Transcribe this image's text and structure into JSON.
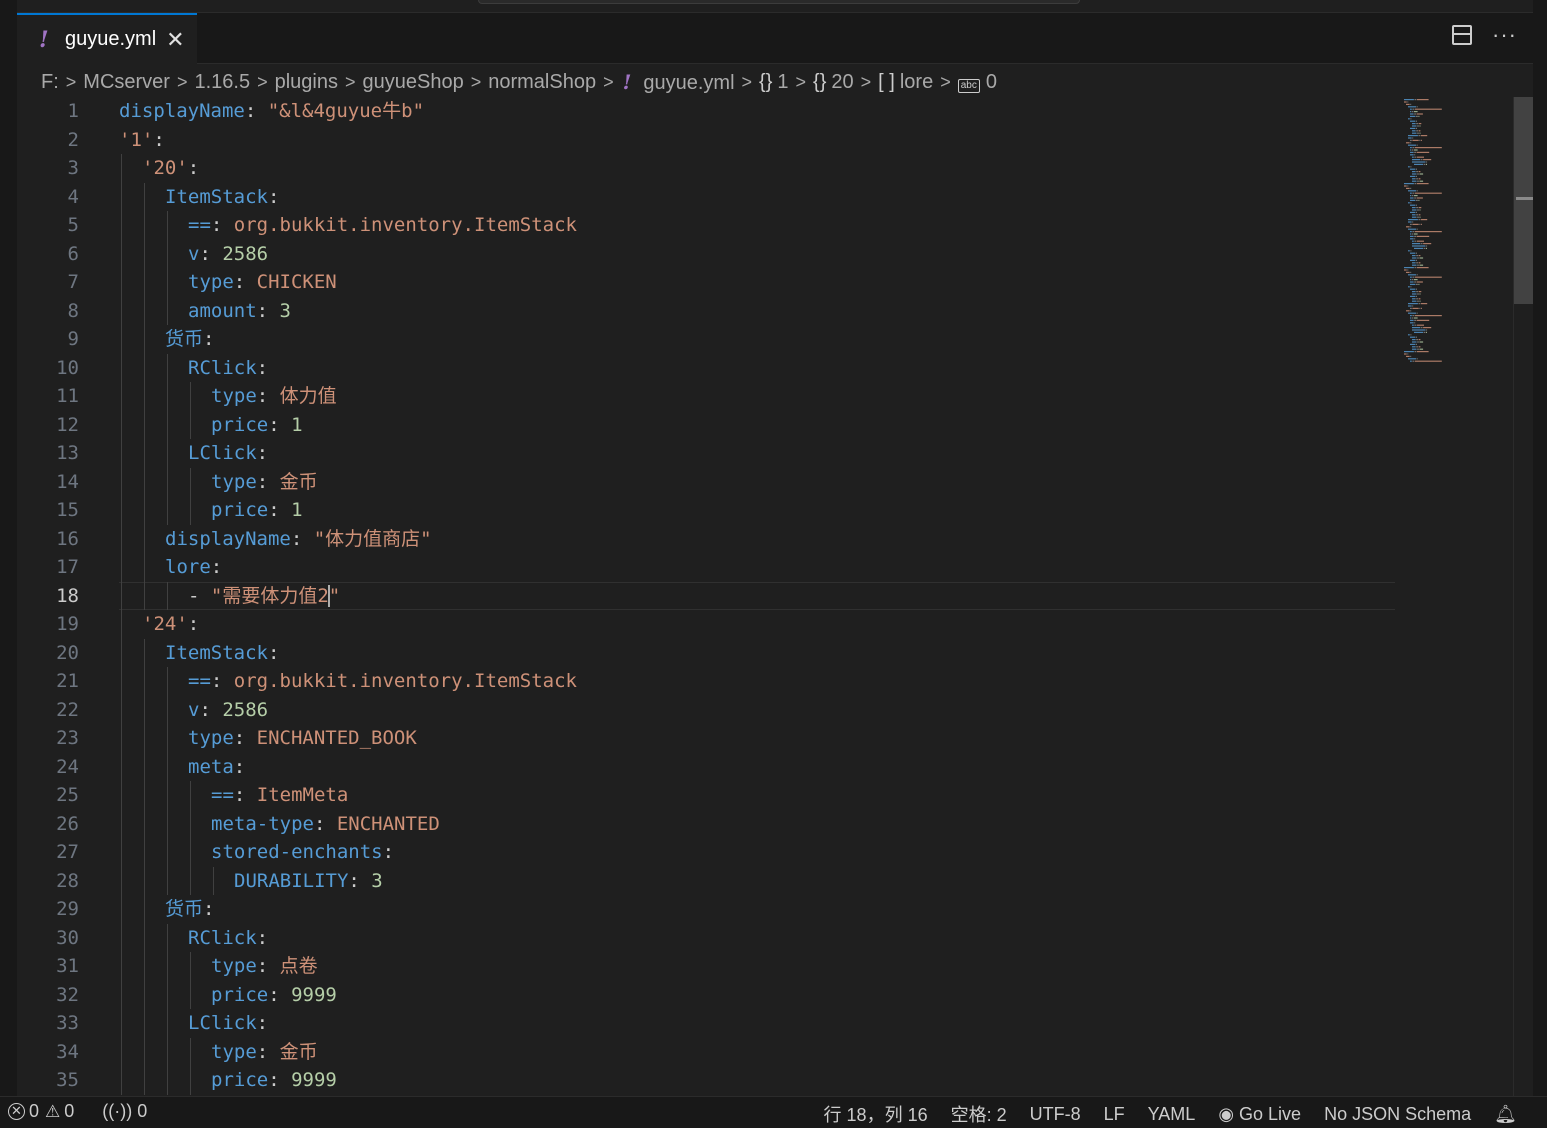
{
  "tab": {
    "icon": "!",
    "label": "guyue.yml",
    "close": "✕"
  },
  "actions": {
    "split_icon": "split-editor-icon",
    "more": "···"
  },
  "breadcrumb": {
    "items": [
      "F:",
      "MCserver",
      "1.16.5",
      "plugins",
      "guyueShop",
      "normalShop"
    ],
    "file_icon": "!",
    "file": "guyue.yml",
    "obj1": "1",
    "obj2": "20",
    "arr": "lore",
    "str_icon": "abc",
    "last": "0",
    "sep": ">"
  },
  "editor": {
    "active_line": 18,
    "lines": [
      {
        "num": "1",
        "indent": 0,
        "tokens": [
          [
            "k",
            "displayName"
          ],
          [
            "p",
            ": "
          ],
          [
            "s",
            "\"&l&4guyue牛b\""
          ]
        ]
      },
      {
        "num": "2",
        "indent": 0,
        "tokens": [
          [
            "s",
            "'1'"
          ],
          [
            "p",
            ":"
          ]
        ]
      },
      {
        "num": "3",
        "indent": 1,
        "tokens": [
          [
            "s",
            "'20'"
          ],
          [
            "p",
            ":"
          ]
        ]
      },
      {
        "num": "4",
        "indent": 2,
        "tokens": [
          [
            "k",
            "ItemStack"
          ],
          [
            "p",
            ":"
          ]
        ]
      },
      {
        "num": "5",
        "indent": 3,
        "tokens": [
          [
            "k",
            "=="
          ],
          [
            "p",
            ": "
          ],
          [
            "s",
            "org.bukkit.inventory.ItemStack"
          ]
        ]
      },
      {
        "num": "6",
        "indent": 3,
        "tokens": [
          [
            "k",
            "v"
          ],
          [
            "p",
            ": "
          ],
          [
            "n",
            "2586"
          ]
        ]
      },
      {
        "num": "7",
        "indent": 3,
        "tokens": [
          [
            "k",
            "type"
          ],
          [
            "p",
            ": "
          ],
          [
            "s",
            "CHICKEN"
          ]
        ]
      },
      {
        "num": "8",
        "indent": 3,
        "tokens": [
          [
            "k",
            "amount"
          ],
          [
            "p",
            ": "
          ],
          [
            "n",
            "3"
          ]
        ]
      },
      {
        "num": "9",
        "indent": 2,
        "tokens": [
          [
            "k",
            "货币"
          ],
          [
            "p",
            ":"
          ]
        ]
      },
      {
        "num": "10",
        "indent": 3,
        "tokens": [
          [
            "k",
            "RClick"
          ],
          [
            "p",
            ":"
          ]
        ]
      },
      {
        "num": "11",
        "indent": 4,
        "tokens": [
          [
            "k",
            "type"
          ],
          [
            "p",
            ": "
          ],
          [
            "s",
            "体力值"
          ]
        ]
      },
      {
        "num": "12",
        "indent": 4,
        "tokens": [
          [
            "k",
            "price"
          ],
          [
            "p",
            ": "
          ],
          [
            "n",
            "1"
          ]
        ]
      },
      {
        "num": "13",
        "indent": 3,
        "tokens": [
          [
            "k",
            "LClick"
          ],
          [
            "p",
            ":"
          ]
        ]
      },
      {
        "num": "14",
        "indent": 4,
        "tokens": [
          [
            "k",
            "type"
          ],
          [
            "p",
            ": "
          ],
          [
            "s",
            "金币"
          ]
        ]
      },
      {
        "num": "15",
        "indent": 4,
        "tokens": [
          [
            "k",
            "price"
          ],
          [
            "p",
            ": "
          ],
          [
            "n",
            "1"
          ]
        ]
      },
      {
        "num": "16",
        "indent": 2,
        "tokens": [
          [
            "k",
            "displayName"
          ],
          [
            "p",
            ": "
          ],
          [
            "s",
            "\"体力值商店\""
          ]
        ]
      },
      {
        "num": "17",
        "indent": 2,
        "tokens": [
          [
            "k",
            "lore"
          ],
          [
            "p",
            ":"
          ]
        ]
      },
      {
        "num": "18",
        "indent": 3,
        "tokens": [
          [
            "p",
            "- "
          ],
          [
            "s",
            "\"需要体力值2"
          ],
          [
            "c",
            ""
          ],
          [
            "s",
            "\""
          ]
        ]
      },
      {
        "num": "19",
        "indent": 1,
        "tokens": [
          [
            "s",
            "'24'"
          ],
          [
            "p",
            ":"
          ]
        ]
      },
      {
        "num": "20",
        "indent": 2,
        "tokens": [
          [
            "k",
            "ItemStack"
          ],
          [
            "p",
            ":"
          ]
        ]
      },
      {
        "num": "21",
        "indent": 3,
        "tokens": [
          [
            "k",
            "=="
          ],
          [
            "p",
            ": "
          ],
          [
            "s",
            "org.bukkit.inventory.ItemStack"
          ]
        ]
      },
      {
        "num": "22",
        "indent": 3,
        "tokens": [
          [
            "k",
            "v"
          ],
          [
            "p",
            ": "
          ],
          [
            "n",
            "2586"
          ]
        ]
      },
      {
        "num": "23",
        "indent": 3,
        "tokens": [
          [
            "k",
            "type"
          ],
          [
            "p",
            ": "
          ],
          [
            "s",
            "ENCHANTED_BOOK"
          ]
        ]
      },
      {
        "num": "24",
        "indent": 3,
        "tokens": [
          [
            "k",
            "meta"
          ],
          [
            "p",
            ":"
          ]
        ]
      },
      {
        "num": "25",
        "indent": 4,
        "tokens": [
          [
            "k",
            "=="
          ],
          [
            "p",
            ": "
          ],
          [
            "s",
            "ItemMeta"
          ]
        ]
      },
      {
        "num": "26",
        "indent": 4,
        "tokens": [
          [
            "k",
            "meta-type"
          ],
          [
            "p",
            ": "
          ],
          [
            "s",
            "ENCHANTED"
          ]
        ]
      },
      {
        "num": "27",
        "indent": 4,
        "tokens": [
          [
            "k",
            "stored-enchants"
          ],
          [
            "p",
            ":"
          ]
        ]
      },
      {
        "num": "28",
        "indent": 5,
        "tokens": [
          [
            "k",
            "DURABILITY"
          ],
          [
            "p",
            ": "
          ],
          [
            "n",
            "3"
          ]
        ]
      },
      {
        "num": "29",
        "indent": 2,
        "tokens": [
          [
            "k",
            "货币"
          ],
          [
            "p",
            ":"
          ]
        ]
      },
      {
        "num": "30",
        "indent": 3,
        "tokens": [
          [
            "k",
            "RClick"
          ],
          [
            "p",
            ":"
          ]
        ]
      },
      {
        "num": "31",
        "indent": 4,
        "tokens": [
          [
            "k",
            "type"
          ],
          [
            "p",
            ": "
          ],
          [
            "s",
            "点卷"
          ]
        ]
      },
      {
        "num": "32",
        "indent": 4,
        "tokens": [
          [
            "k",
            "price"
          ],
          [
            "p",
            ": "
          ],
          [
            "n",
            "9999"
          ]
        ]
      },
      {
        "num": "33",
        "indent": 3,
        "tokens": [
          [
            "k",
            "LClick"
          ],
          [
            "p",
            ":"
          ]
        ]
      },
      {
        "num": "34",
        "indent": 4,
        "tokens": [
          [
            "k",
            "type"
          ],
          [
            "p",
            ": "
          ],
          [
            "s",
            "金币"
          ]
        ]
      },
      {
        "num": "35",
        "indent": 4,
        "tokens": [
          [
            "k",
            "price"
          ],
          [
            "p",
            ": "
          ],
          [
            "n",
            "9999"
          ]
        ]
      }
    ]
  },
  "status": {
    "errors": "0",
    "warnings": "0",
    "ports": "0",
    "position": "行 18，列 16",
    "spaces": "空格: 2",
    "encoding": "UTF-8",
    "eol": "LF",
    "language": "YAML",
    "golive": "Go Live",
    "schema": "No JSON Schema"
  },
  "colors": {
    "keyword": "#569cd6",
    "string": "#ce9178",
    "number": "#b5cea8",
    "accent": "#0078d4",
    "yaml_icon": "#a074c4"
  }
}
